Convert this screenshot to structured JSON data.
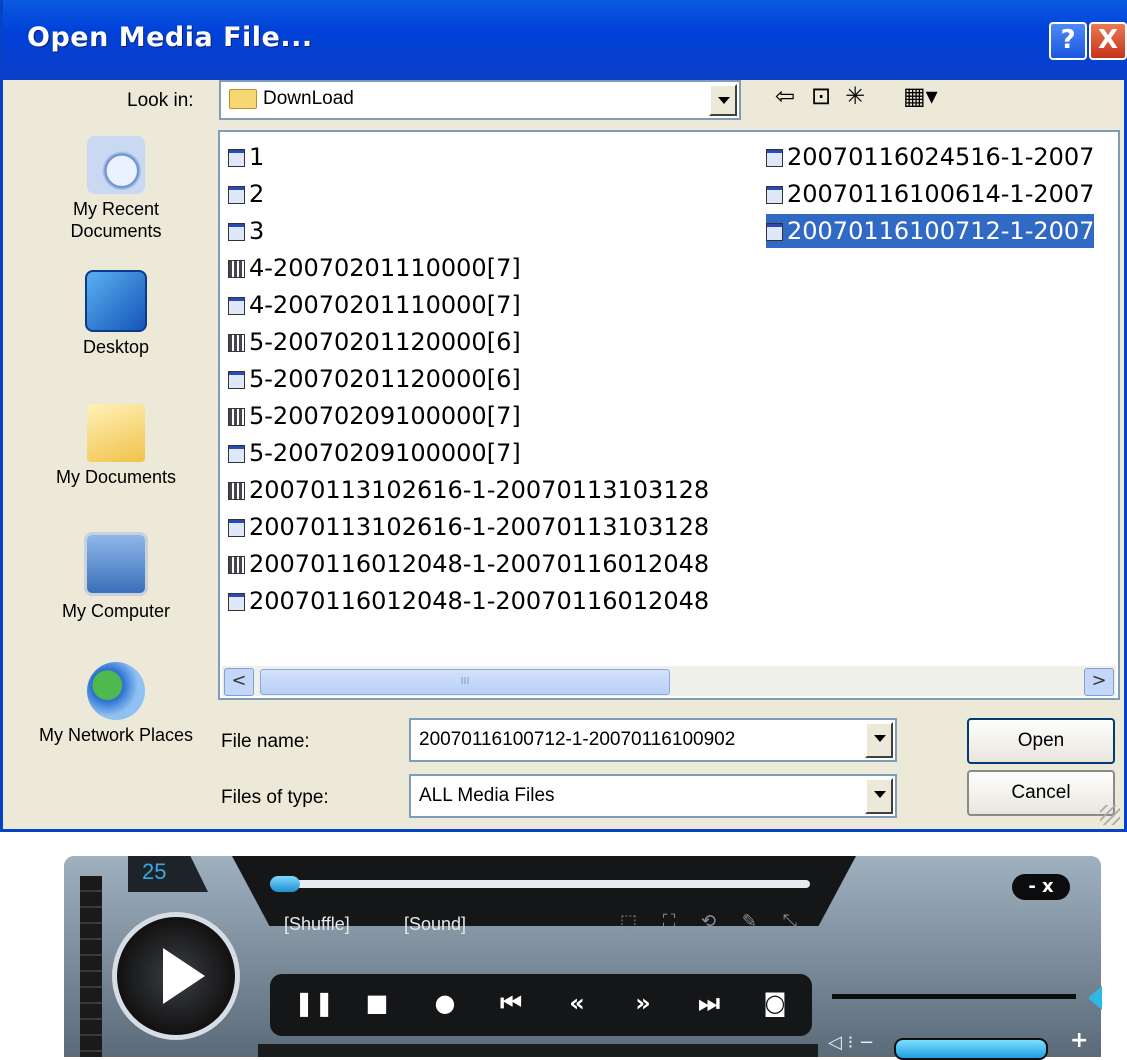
{
  "dialog": {
    "title": "Open Media File...",
    "help_label": "?",
    "close_label": "X",
    "look_in_label": "Look in:",
    "look_in_value": "DownLoad",
    "toolbar": {
      "back": "⇦",
      "up": "⊡",
      "newfolder": "✳",
      "views": "▦▾"
    },
    "places": [
      {
        "label": "My Recent Documents"
      },
      {
        "label": "Desktop"
      },
      {
        "label": "My Documents"
      },
      {
        "label": "My Computer"
      },
      {
        "label": "My Network Places"
      }
    ],
    "files_col1": [
      {
        "name": "1",
        "kind": "w"
      },
      {
        "name": "2",
        "kind": "w"
      },
      {
        "name": "3",
        "kind": "w"
      },
      {
        "name": "4-20070201110000[7]",
        "kind": "m"
      },
      {
        "name": "4-20070201110000[7]",
        "kind": "w"
      },
      {
        "name": "5-20070201120000[6]",
        "kind": "m"
      },
      {
        "name": "5-20070201120000[6]",
        "kind": "w"
      },
      {
        "name": "5-20070209100000[7]",
        "kind": "m"
      },
      {
        "name": "5-20070209100000[7]",
        "kind": "w"
      },
      {
        "name": "20070113102616-1-20070113103128",
        "kind": "m"
      },
      {
        "name": "20070113102616-1-20070113103128",
        "kind": "w"
      },
      {
        "name": "20070116012048-1-20070116012048",
        "kind": "m"
      },
      {
        "name": "20070116012048-1-20070116012048",
        "kind": "w"
      }
    ],
    "files_col2": [
      {
        "name": "20070116024516-1-2007",
        "kind": "w"
      },
      {
        "name": "20070116100614-1-2007",
        "kind": "w"
      },
      {
        "name": "20070116100712-1-2007",
        "kind": "w",
        "selected": true
      }
    ],
    "scroll": {
      "left": "<",
      "right": ">",
      "grip": "III"
    },
    "file_name_label": "File name:",
    "file_name_value": "20070116100712-1-20070116100902",
    "files_of_type_label": "Files of type:",
    "files_of_type_value": "ALL Media Files",
    "open_label": "Open",
    "cancel_label": "Cancel"
  },
  "player": {
    "track_number": "25",
    "shuffle_label": "[Shuffle]",
    "sound_label": "[Sound]",
    "top_icons": "⬚ ⛶ ⟲ ✎ ⤡",
    "window_buttons": "- x",
    "controls": [
      {
        "name": "pause-button",
        "glyph": "❚❚"
      },
      {
        "name": "stop-button",
        "glyph": "■"
      },
      {
        "name": "record-button",
        "glyph": "●"
      },
      {
        "name": "previous-button",
        "glyph": "⏮"
      },
      {
        "name": "rewind-button",
        "glyph": "«"
      },
      {
        "name": "forward-button",
        "glyph": "»"
      },
      {
        "name": "next-button",
        "glyph": "⏭"
      },
      {
        "name": "snapshot-button",
        "glyph": "◙"
      }
    ],
    "volume_icon": "◁ ⁝ −",
    "volume_plus": "+"
  }
}
